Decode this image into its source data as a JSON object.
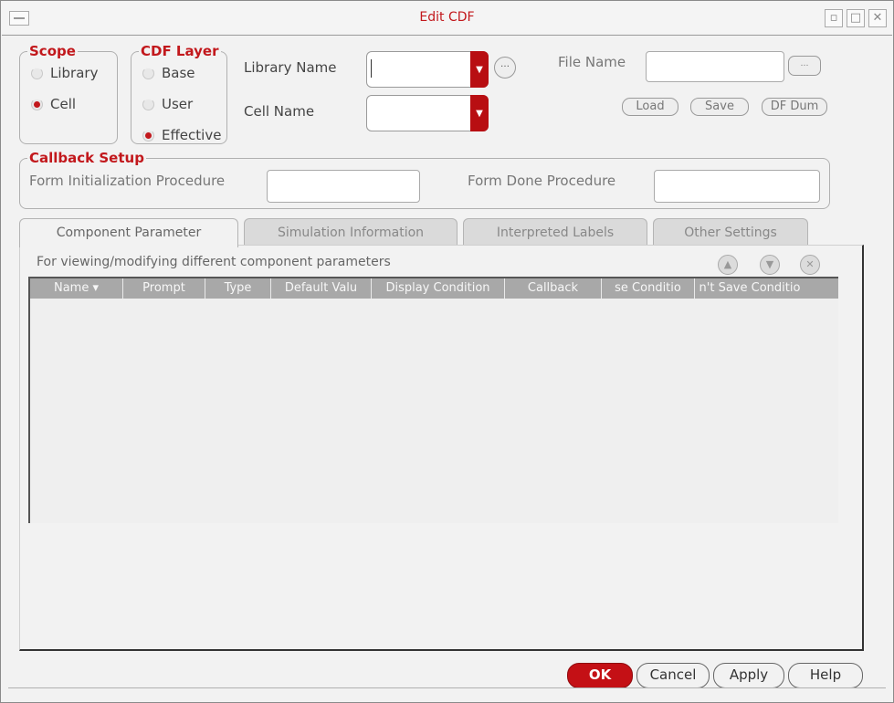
{
  "window": {
    "title": "Edit CDF"
  },
  "scope": {
    "title": "Scope",
    "options": [
      {
        "label": "Library",
        "selected": false
      },
      {
        "label": "Cell",
        "selected": true
      }
    ]
  },
  "cdf_layer": {
    "title": "CDF Layer",
    "options": [
      {
        "label": "Base",
        "selected": false
      },
      {
        "label": "User",
        "selected": false
      },
      {
        "label": "Effective",
        "selected": true
      }
    ]
  },
  "fields": {
    "library_name_label": "Library Name",
    "library_name_value": "",
    "cell_name_label": "Cell Name",
    "cell_name_value": "",
    "file_name_label": "File Name",
    "file_name_value": ""
  },
  "file_buttons": {
    "load": "Load",
    "save": "Save",
    "dump": "DF Dum"
  },
  "callback_setup": {
    "title": "Callback Setup",
    "init_label": "Form Initialization Procedure",
    "done_label": "Form Done Procedure"
  },
  "tabs": [
    {
      "label": "Component Parameter",
      "active": true
    },
    {
      "label": "Simulation Information",
      "active": false
    },
    {
      "label": "Interpreted Labels",
      "active": false
    },
    {
      "label": "Other Settings",
      "active": false
    }
  ],
  "panel": {
    "description": "For viewing/modifying different component parameters",
    "columns": [
      "Name",
      "Prompt",
      "Type",
      "Default Valu",
      "Display Condition",
      "Callback",
      "se Conditio",
      "n't Save Conditio"
    ]
  },
  "footer": {
    "ok": "OK",
    "cancel": "Cancel",
    "apply": "Apply",
    "help": "Help"
  },
  "colors": {
    "accent": "#c2181c",
    "table_header": "#a8a8a8"
  },
  "icons": [
    "window-menu-icon",
    "minimize-icon",
    "maximize-icon",
    "close-icon",
    "dropdown-arrow-icon",
    "ellipsis-icon",
    "move-up-icon",
    "move-down-icon",
    "delete-icon"
  ]
}
